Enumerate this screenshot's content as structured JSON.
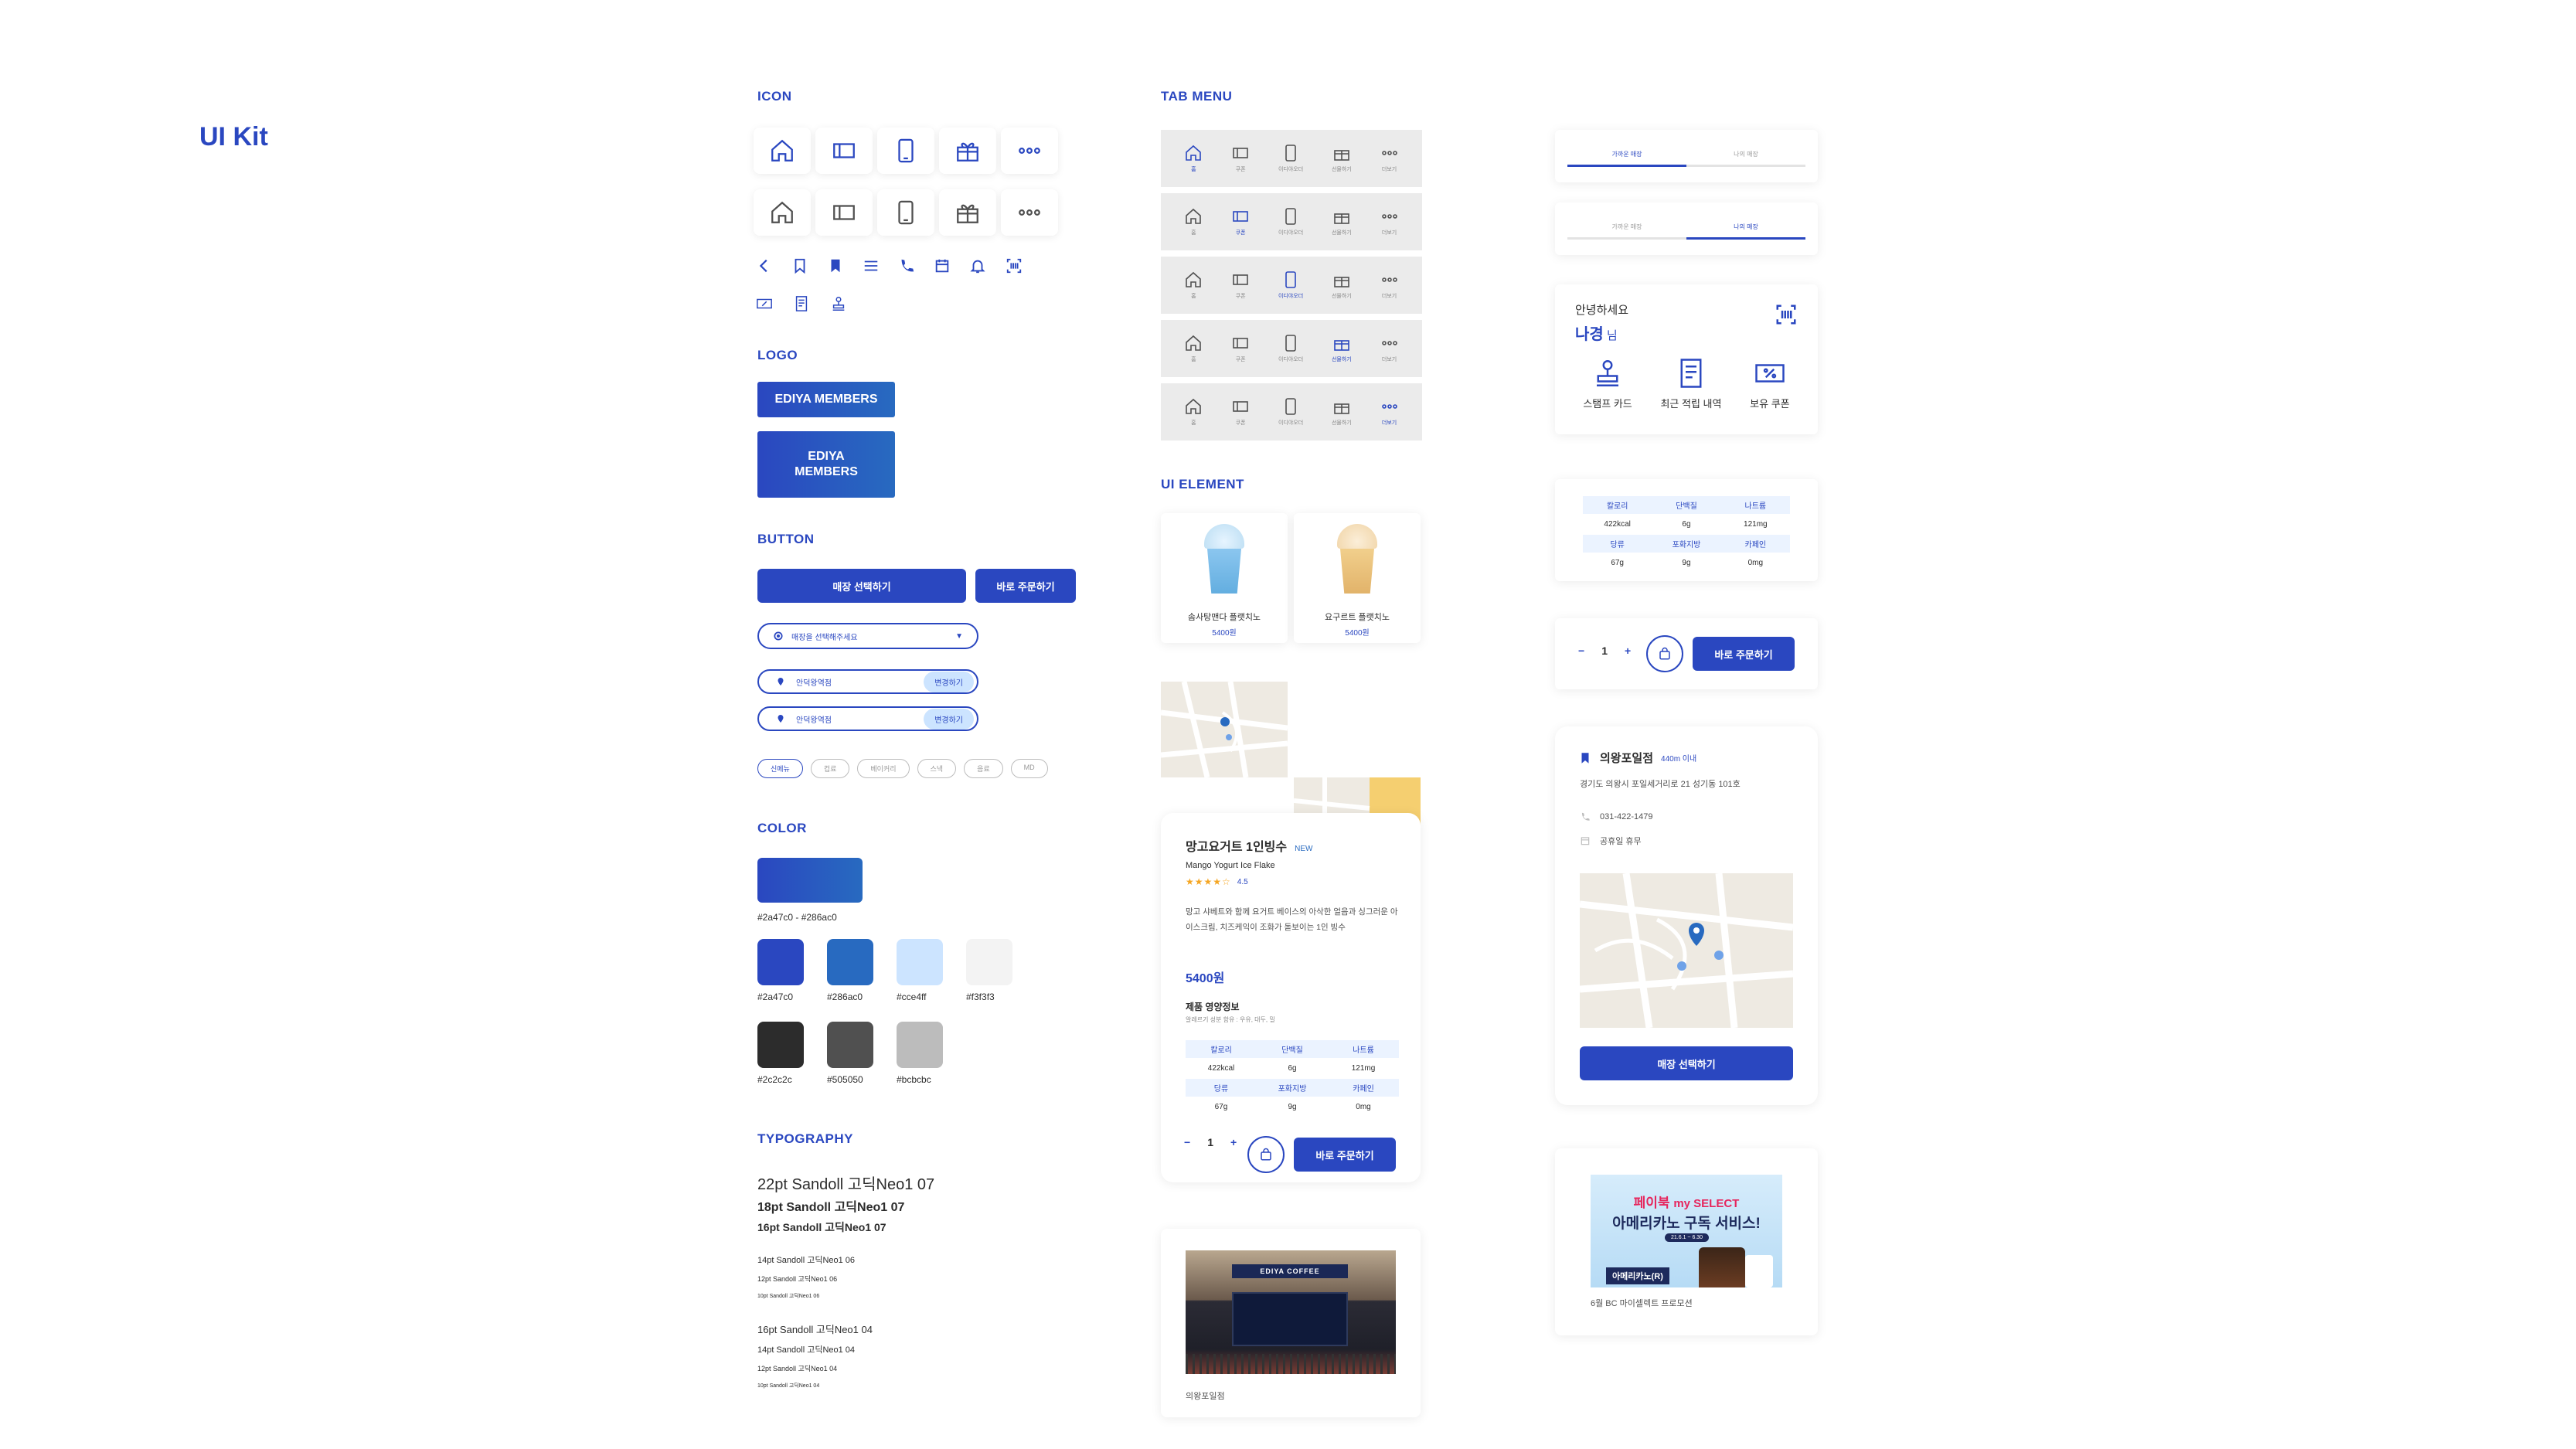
{
  "page_title": "UI Kit",
  "sections": {
    "icon": "ICON",
    "logo": "LOGO",
    "button": "BUTTON",
    "color": "COLOR",
    "typography": "TYPOGRAPHY",
    "tab_menu": "TAB MENU",
    "ui_element": "UI ELEMENT"
  },
  "icons_row": [
    "home-icon",
    "coupon-icon",
    "phone-icon",
    "gift-icon",
    "more-icon"
  ],
  "small_icons": [
    "back-icon",
    "bookmark-outline-icon",
    "bookmark-icon",
    "menu-icon",
    "call-icon",
    "calendar-icon",
    "bell-icon",
    "barcode-icon",
    "coupon-percent-icon",
    "receipt-icon",
    "stamp-icon"
  ],
  "logo": {
    "wide": "EDIYA MEMBERS",
    "stack_line1": "EDIYA",
    "stack_line2": "MEMBERS"
  },
  "buttons": {
    "select_store": "매장 선택하기",
    "order_now": "바로 주문하기",
    "dropdown_placeholder": "매장을 선택해주세요",
    "location_1": "안덕왕역점",
    "location_1_action": "변경하기",
    "location_2": "안덕왕역점",
    "location_2_action": "변경하기",
    "chips": [
      "신메뉴",
      "컵료",
      "베이커리",
      "스낵",
      "음료",
      "MD"
    ]
  },
  "colors": {
    "gradient_label": "#2a47c0 - #286ac0",
    "swatches": [
      {
        "hex": "#2a47c0",
        "label": "#2a47c0"
      },
      {
        "hex": "#286ac0",
        "label": "#286ac0"
      },
      {
        "hex": "#cce4ff",
        "label": "#cce4ff"
      },
      {
        "hex": "#f3f3f3",
        "label": "#f3f3f3"
      },
      {
        "hex": "#2c2c2c",
        "label": "#2c2c2c"
      },
      {
        "hex": "#505050",
        "label": "#505050"
      },
      {
        "hex": "#bcbcbc",
        "label": "#bcbcbc"
      }
    ]
  },
  "typography": [
    "22pt Sandoll 고딕Neo1 07",
    "18pt Sandoll 고딕Neo1 07",
    "16pt Sandoll 고딕Neo1 07",
    "14pt Sandoll 고딕Neo1 06",
    "12pt Sandoll 고딕Neo1 06",
    "10pt Sandoll 고딕Neo1 06",
    "16pt Sandoll 고딕Neo1 04",
    "14pt Sandoll 고딕Neo1 04",
    "12pt Sandoll 고딕Neo1 04",
    "10pt Sandoll 고딕Neo1 04"
  ],
  "tab_labels": [
    "홈",
    "쿠폰",
    "이디야오더",
    "선물하기",
    "더보기"
  ],
  "menu_cards": [
    {
      "name": "솜사탕맨다 플랫치노",
      "price": "5400원"
    },
    {
      "name": "요구르트 플랫치노",
      "price": "5400원"
    }
  ],
  "product_detail": {
    "title": "망고요거트 1인빙수",
    "badge": "NEW",
    "subtitle": "Mango Yogurt Ice Flake",
    "rating": "4.5",
    "description": "망고 샤베트와 함께 요거트 베이스의 아삭한 얼음과 싱그러운 아이스크림, 치즈케익이 조화가 돋보이는 1인 빙수",
    "price": "5400원",
    "nutrition_title": "제품 영양정보",
    "nutrition_note": "알레르기 성분 함유 : 우유, 대두, 밀",
    "qty": "1",
    "order": "바로 주문하기"
  },
  "nutrition": {
    "headers1": [
      "칼로리",
      "단백질",
      "나트륨"
    ],
    "values1": [
      "422kcal",
      "6g",
      "121mg"
    ],
    "headers2": [
      "당류",
      "포화지방",
      "카페인"
    ],
    "values2": [
      "67g",
      "9g",
      "0mg"
    ]
  },
  "store_photo": {
    "sign": "EDIYA COFFEE",
    "label": "의왕포일점"
  },
  "tabs_toggle": {
    "a": "가까운 매장",
    "b": "나의 매장"
  },
  "member": {
    "greeting": "안녕하세요",
    "name": "나경",
    "suffix": "님",
    "menu": [
      "스탬프 카드",
      "최근 적립 내역",
      "보유 쿠폰"
    ]
  },
  "order_row": {
    "qty": "1",
    "order": "바로 주문하기"
  },
  "store_card": {
    "name": "의왕포일점",
    "distance": "440m 이내",
    "address": "경기도 의왕시 포일세거리로 21 성기동 101호",
    "phone": "031-422-1479",
    "holiday": "공휴일 휴무",
    "button": "매장 선택하기"
  },
  "promo": {
    "brand": "페이북",
    "brand2": "my SELECT",
    "headline": "아메리카노 구독 서비스!",
    "dates": "21.6.1 ~ 6.30",
    "tag": "아메리카노(R)",
    "caption": "6월 BC 마이셀렉트 프로모션"
  }
}
